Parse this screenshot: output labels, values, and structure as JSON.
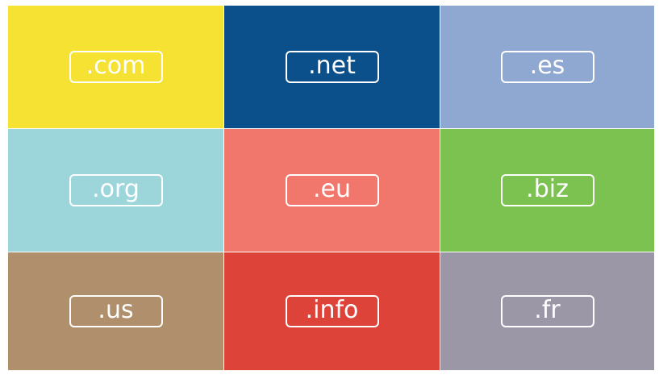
{
  "tiles": [
    {
      "label": ".com",
      "color": "#F6E233"
    },
    {
      "label": ".net",
      "color": "#0B4F8B"
    },
    {
      "label": ".es",
      "color": "#8FA8D1"
    },
    {
      "label": ".org",
      "color": "#9CD6DB"
    },
    {
      "label": ".eu",
      "color": "#F1766B"
    },
    {
      "label": ".biz",
      "color": "#7BC251"
    },
    {
      "label": ".us",
      "color": "#B08F6C"
    },
    {
      "label": ".info",
      "color": "#DE433A"
    },
    {
      "label": ".fr",
      "color": "#9B97A6"
    }
  ]
}
